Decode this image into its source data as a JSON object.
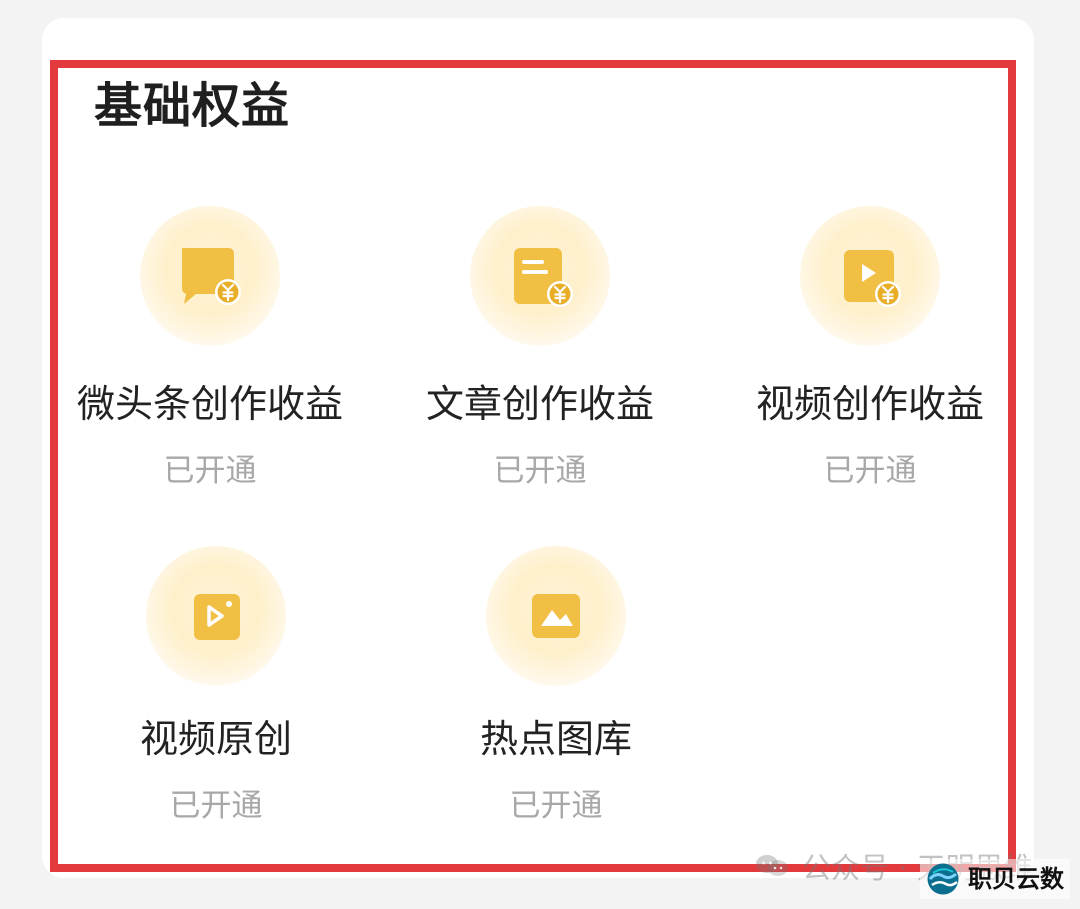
{
  "section": {
    "title": "基础权益"
  },
  "items": [
    {
      "title": "微头条创作收益",
      "status": "已开通",
      "icon": "chat-bubble-yuan-icon"
    },
    {
      "title": "文章创作收益",
      "status": "已开通",
      "icon": "document-yuan-icon"
    },
    {
      "title": "视频创作收益",
      "status": "已开通",
      "icon": "video-yuan-icon"
    },
    {
      "title": "视频原创",
      "status": "已开通",
      "icon": "video-original-icon"
    },
    {
      "title": "热点图库",
      "status": "已开通",
      "icon": "image-library-icon"
    }
  ],
  "watermark": {
    "text": "公众号 · 天明思维",
    "icon": "wechat-icon"
  },
  "brand": {
    "text": "职贝云数",
    "icon": "globe-logo-icon"
  },
  "colors": {
    "highlight_border": "#e23a3d",
    "gold_primary": "#f2bf45",
    "gold_secondary": "#f7d57a",
    "icon_glow": "#fff1cc",
    "status_text": "#a8a8a8",
    "title_text": "#1f1f1f"
  }
}
